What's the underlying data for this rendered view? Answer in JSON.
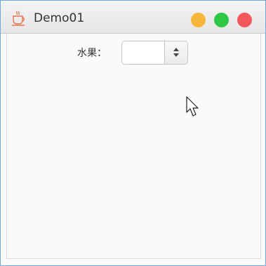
{
  "window": {
    "title": "Demo01",
    "app_icon": "coffee-cup-icon",
    "controls": {
      "minimize_color": "#f6b73c",
      "maximize_color": "#2fc845",
      "close_color": "#f4575a"
    }
  },
  "form": {
    "fruit_label": "水果：",
    "fruit_value": ""
  },
  "cursor": {
    "icon": "mouse-pointer-icon"
  }
}
